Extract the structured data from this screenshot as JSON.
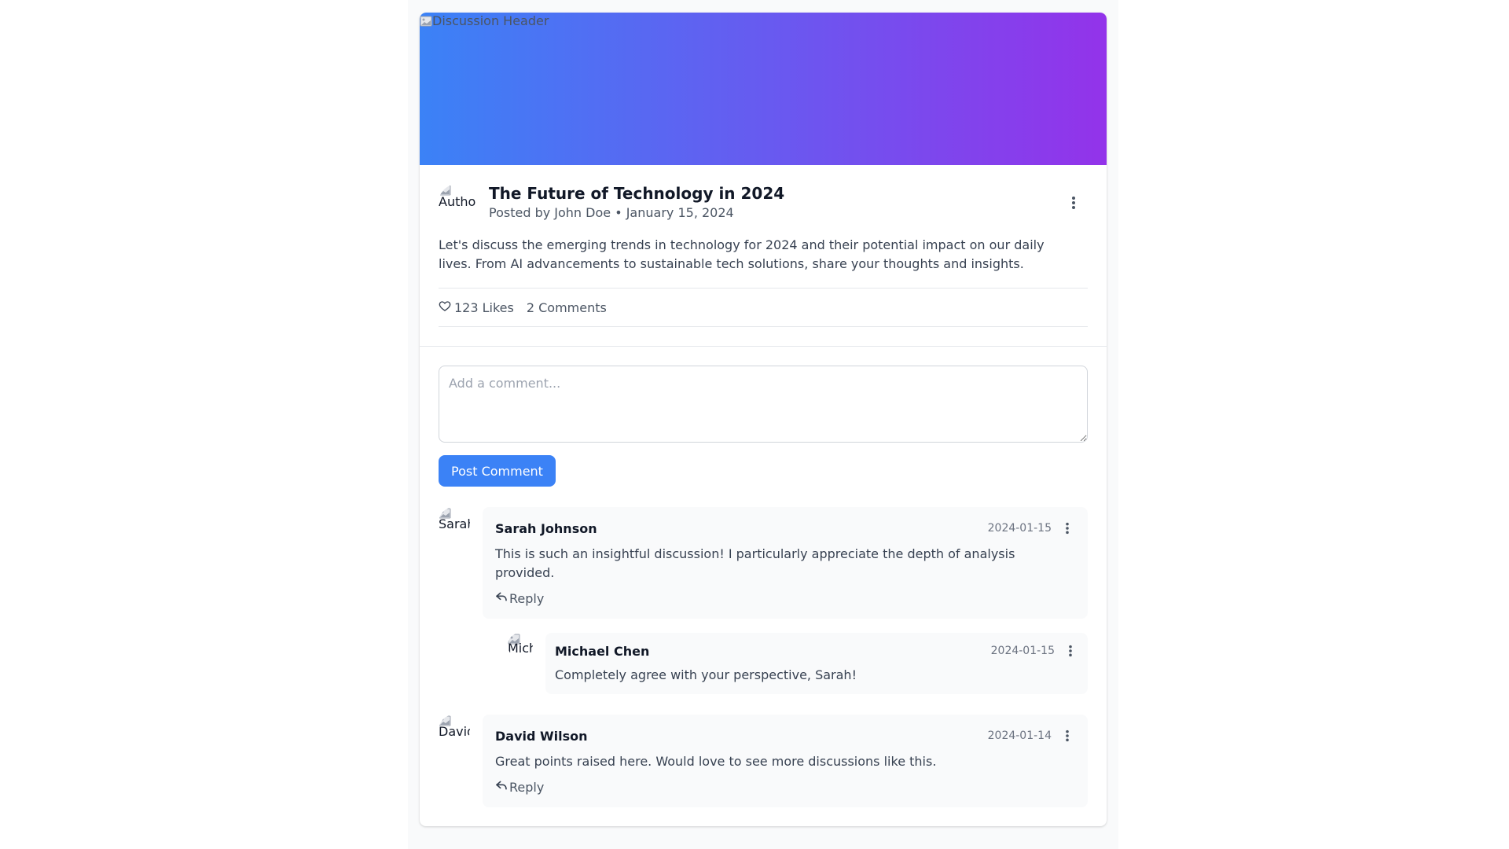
{
  "header": {
    "image_alt": "Discussion Header"
  },
  "post": {
    "author_avatar_alt": "Author",
    "title": "The Future of Technology in 2024",
    "meta": "Posted by John Doe • January 15, 2024",
    "body": "Let's discuss the emerging trends in technology for 2024 and their potential impact on our daily lives. From AI advancements to sustainable tech solutions, share your thoughts and insights.",
    "likes_label": "123 Likes",
    "comments_label": "2 Comments"
  },
  "composer": {
    "placeholder": "Add a comment...",
    "value": "",
    "submit_label": "Post Comment"
  },
  "comments": [
    {
      "avatar_alt": "Sarah Johnson",
      "name": "Sarah Johnson",
      "date": "2024-01-15",
      "text": "This is such an insightful discussion! I particularly appreciate the depth of analysis provided.",
      "reply_label": "Reply",
      "replies": [
        {
          "avatar_alt": "Michael Chen",
          "name": "Michael Chen",
          "date": "2024-01-15",
          "text": "Completely agree with your perspective, Sarah!"
        }
      ]
    },
    {
      "avatar_alt": "David Wilson",
      "name": "David Wilson",
      "date": "2024-01-14",
      "text": "Great points raised here. Would love to see more discussions like this.",
      "reply_label": "Reply"
    }
  ],
  "icons": {
    "more": "more-vertical-icon",
    "like": "heart-icon",
    "reply": "reply-arrow-icon",
    "broken_image": "broken-image-icon"
  },
  "colors": {
    "gradient_start": "#3b82f6",
    "gradient_end": "#9333ea",
    "primary_button": "#3b82f6",
    "bubble_bg": "#f9fafb"
  }
}
